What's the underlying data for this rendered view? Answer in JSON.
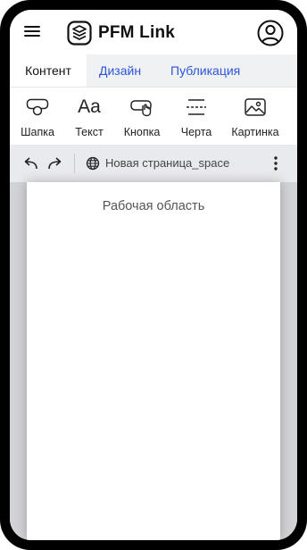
{
  "app": {
    "title": "PFM Link"
  },
  "tabs": [
    {
      "label": "Контент",
      "active": true
    },
    {
      "label": "Дизайн",
      "active": false
    },
    {
      "label": "Публикация",
      "active": false
    }
  ],
  "tools": [
    {
      "label": "Шапка",
      "icon": "header-block-icon"
    },
    {
      "label": "Текст",
      "icon_text": "Aa",
      "icon": "text-icon"
    },
    {
      "label": "Кнопка",
      "icon": "button-click-icon"
    },
    {
      "label": "Черта",
      "icon": "divider-line-icon"
    },
    {
      "label": "Картинка",
      "icon": "image-icon"
    }
  ],
  "pagebar": {
    "page_name": "Новая страница_space"
  },
  "workspace": {
    "label": "Рабочая область"
  },
  "colors": {
    "accent": "#2b55d9",
    "tab_bar": "#f0f1f3",
    "page_bar": "#e9eaed",
    "work_bg": "#d2d3d6"
  }
}
